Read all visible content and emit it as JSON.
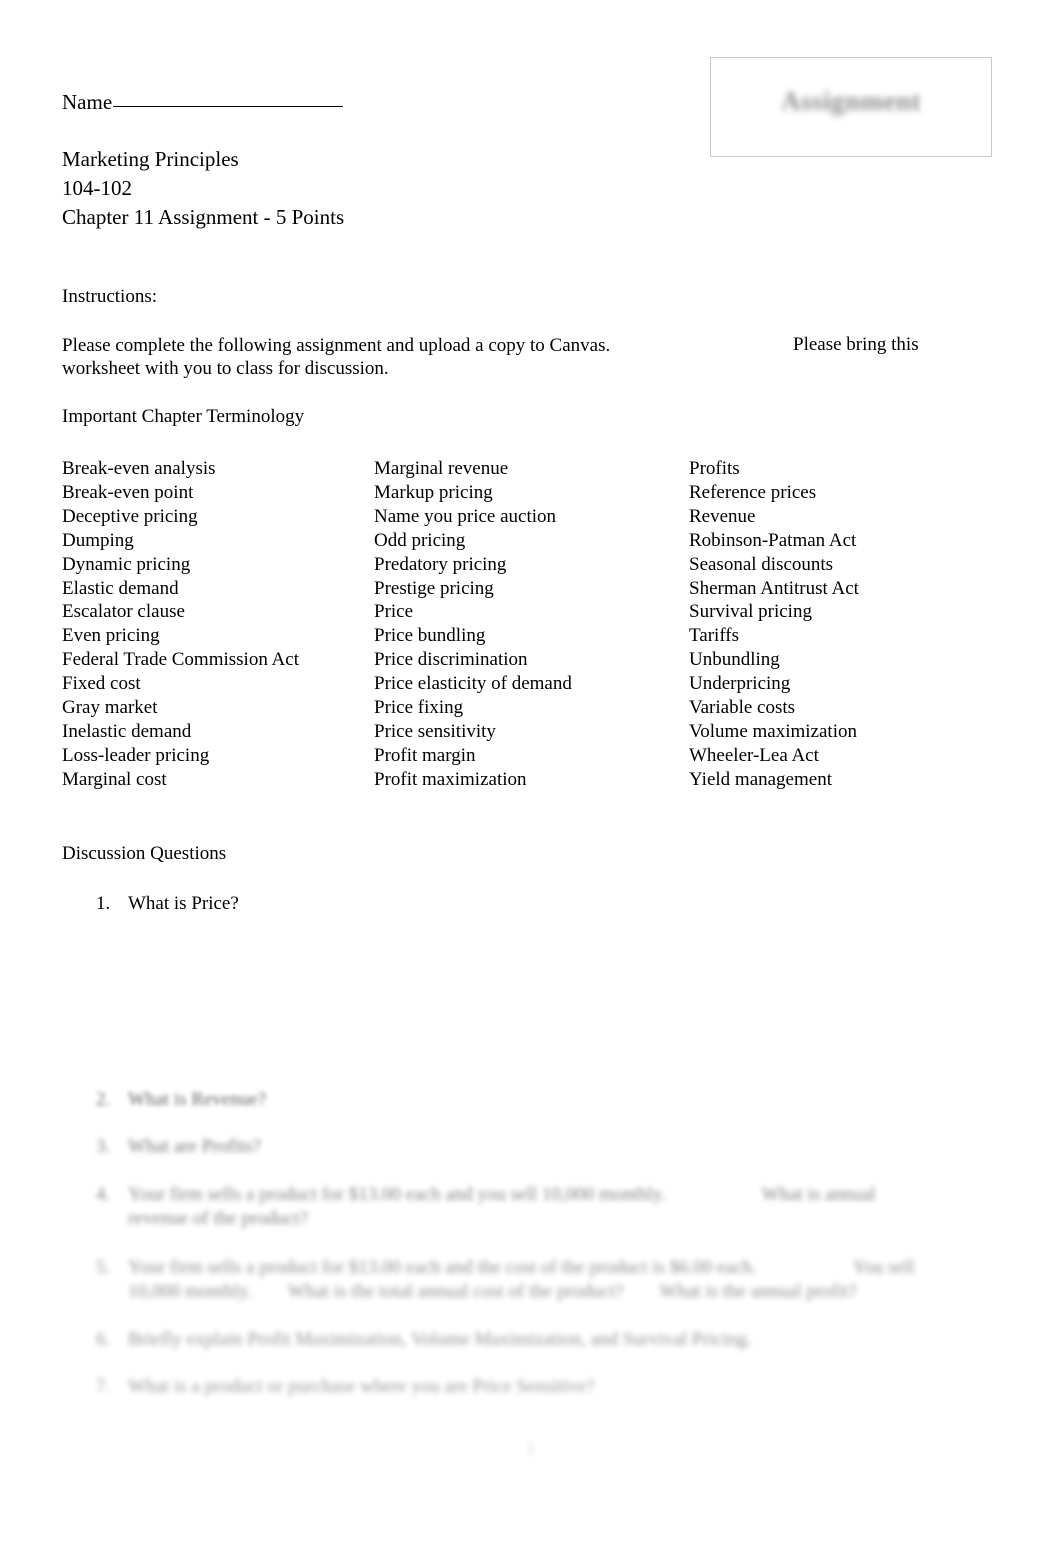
{
  "document": {
    "name_label": "Name",
    "stamp_text": "Assignment",
    "page_number": "1"
  },
  "header": {
    "course_title": "Marketing Principles",
    "course_code": "104-102",
    "assignment_title": "Chapter 11 Assignment - 5 Points"
  },
  "instructions": {
    "label": "Instructions:",
    "body": "Please complete the following assignment and upload a copy to Canvas.",
    "body_continued": "worksheet with you to class for discussion.",
    "right_fragment": "Please bring this"
  },
  "terminology": {
    "heading": "Important Chapter Terminology",
    "column1": [
      "Break-even analysis",
      "Break-even point",
      "Deceptive pricing",
      "Dumping",
      "Dynamic pricing",
      "Elastic demand",
      "Escalator clause",
      "Even pricing",
      "Federal Trade Commission Act",
      "Fixed cost",
      "Gray market",
      "Inelastic demand",
      "Loss-leader pricing",
      "Marginal cost"
    ],
    "column2": [
      "Marginal revenue",
      "Markup pricing",
      "Name you price auction",
      "Odd pricing",
      "Predatory pricing",
      "Prestige pricing",
      "Price",
      "Price bundling",
      "Price discrimination",
      "Price elasticity of demand",
      "Price fixing",
      "Price sensitivity",
      "Profit margin",
      "Profit maximization"
    ],
    "column3": [
      "Profits",
      "Reference prices",
      "Revenue",
      "Robinson-Patman Act",
      "Seasonal discounts",
      "Sherman Antitrust Act",
      "Survival pricing",
      "Tariffs",
      "Unbundling",
      "Underpricing",
      "Variable costs",
      "Volume maximization",
      "Wheeler-Lea Act",
      "Yield management"
    ]
  },
  "discussion": {
    "heading": "Discussion Questions",
    "questions": [
      {
        "number": "1.",
        "text": "What is Price?"
      },
      {
        "number": "2.",
        "text": "What is Revenue?"
      },
      {
        "number": "3.",
        "text": "What are Profits?"
      },
      {
        "number": "4.",
        "text": "Your firm sells a product for $13.00 each and you sell 10,000 monthly.",
        "tail": "What is annual",
        "line2": "revenue of the product?"
      },
      {
        "number": "5.",
        "text": "Your firm sells a product for $13.00 each and the cost of the product is $6.00 each.",
        "tail": "You sell",
        "line2": "10,000 monthly.",
        "line2_tail": "What is the total annual cost of the product?",
        "line2_tail2": "What is the annual profit?"
      },
      {
        "number": "6.",
        "text": "Briefly explain Profit Maximization, Volume Maximization, and Survival Pricing."
      },
      {
        "number": "7.",
        "text": "What is a product or purchase where you are Price Sensitive?"
      }
    ]
  }
}
